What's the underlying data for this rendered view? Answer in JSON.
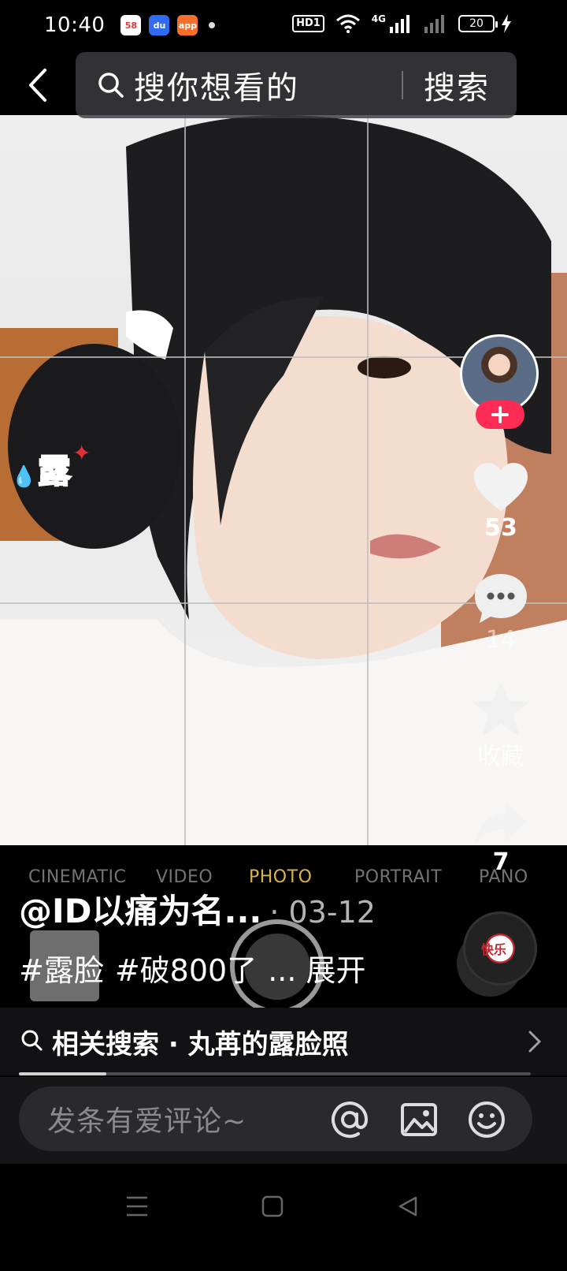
{
  "status_bar": {
    "time": "10:40",
    "apps": [
      "58",
      "du",
      "app"
    ],
    "hd": "HD1",
    "network": "4G",
    "battery": "20"
  },
  "top_bar": {
    "search_placeholder": "搜你想看的",
    "search_button": "搜索"
  },
  "photo": {
    "sticker_text": "露"
  },
  "camera_overlay": {
    "modes": [
      "CINEMATIC",
      "VIDEO",
      "PHOTO",
      "PORTRAIT",
      "PANO"
    ],
    "active_mode": "PHOTO"
  },
  "right_rail": {
    "likes": "53",
    "comments": "14",
    "favorite_label": "收藏",
    "shares": "7"
  },
  "caption": {
    "author": "@ID以痛为名...",
    "date": "· 03-12",
    "tags": [
      "#露脸",
      "#破800了",
      "... 展开"
    ]
  },
  "music": {
    "label": "快乐"
  },
  "related_search": {
    "text": "相关搜索 · 丸苒的露脸照",
    "progress": 0.17
  },
  "comment_bar": {
    "placeholder": "发条有爱评论~"
  },
  "colors": {
    "follow": "#fe2c55",
    "active_mode": "#f0c85a"
  }
}
